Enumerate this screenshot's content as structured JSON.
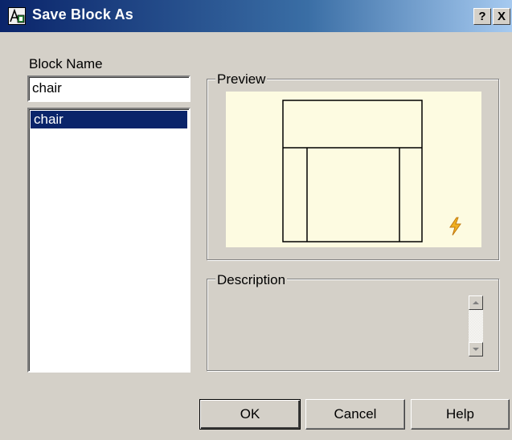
{
  "window": {
    "title": "Save Block As",
    "help_button": "?",
    "close_button": "X"
  },
  "block_name": {
    "label": "Block Name",
    "value": "chair",
    "list_items": [
      "chair"
    ]
  },
  "preview": {
    "label": "Preview"
  },
  "description": {
    "label": "Description"
  },
  "buttons": {
    "ok": "OK",
    "cancel": "Cancel",
    "help": "Help"
  },
  "colors": {
    "dialog_bg": "#d4d0c8",
    "title_gradient_start": "#0a246a",
    "title_gradient_end": "#a6caf0",
    "selection": "#0a246a",
    "preview_bg": "#fdfbe1",
    "lightning": "#e0a020"
  },
  "icons": {
    "title": "autocad-block-icon",
    "preview_badge": "lightning-bolt-icon"
  }
}
